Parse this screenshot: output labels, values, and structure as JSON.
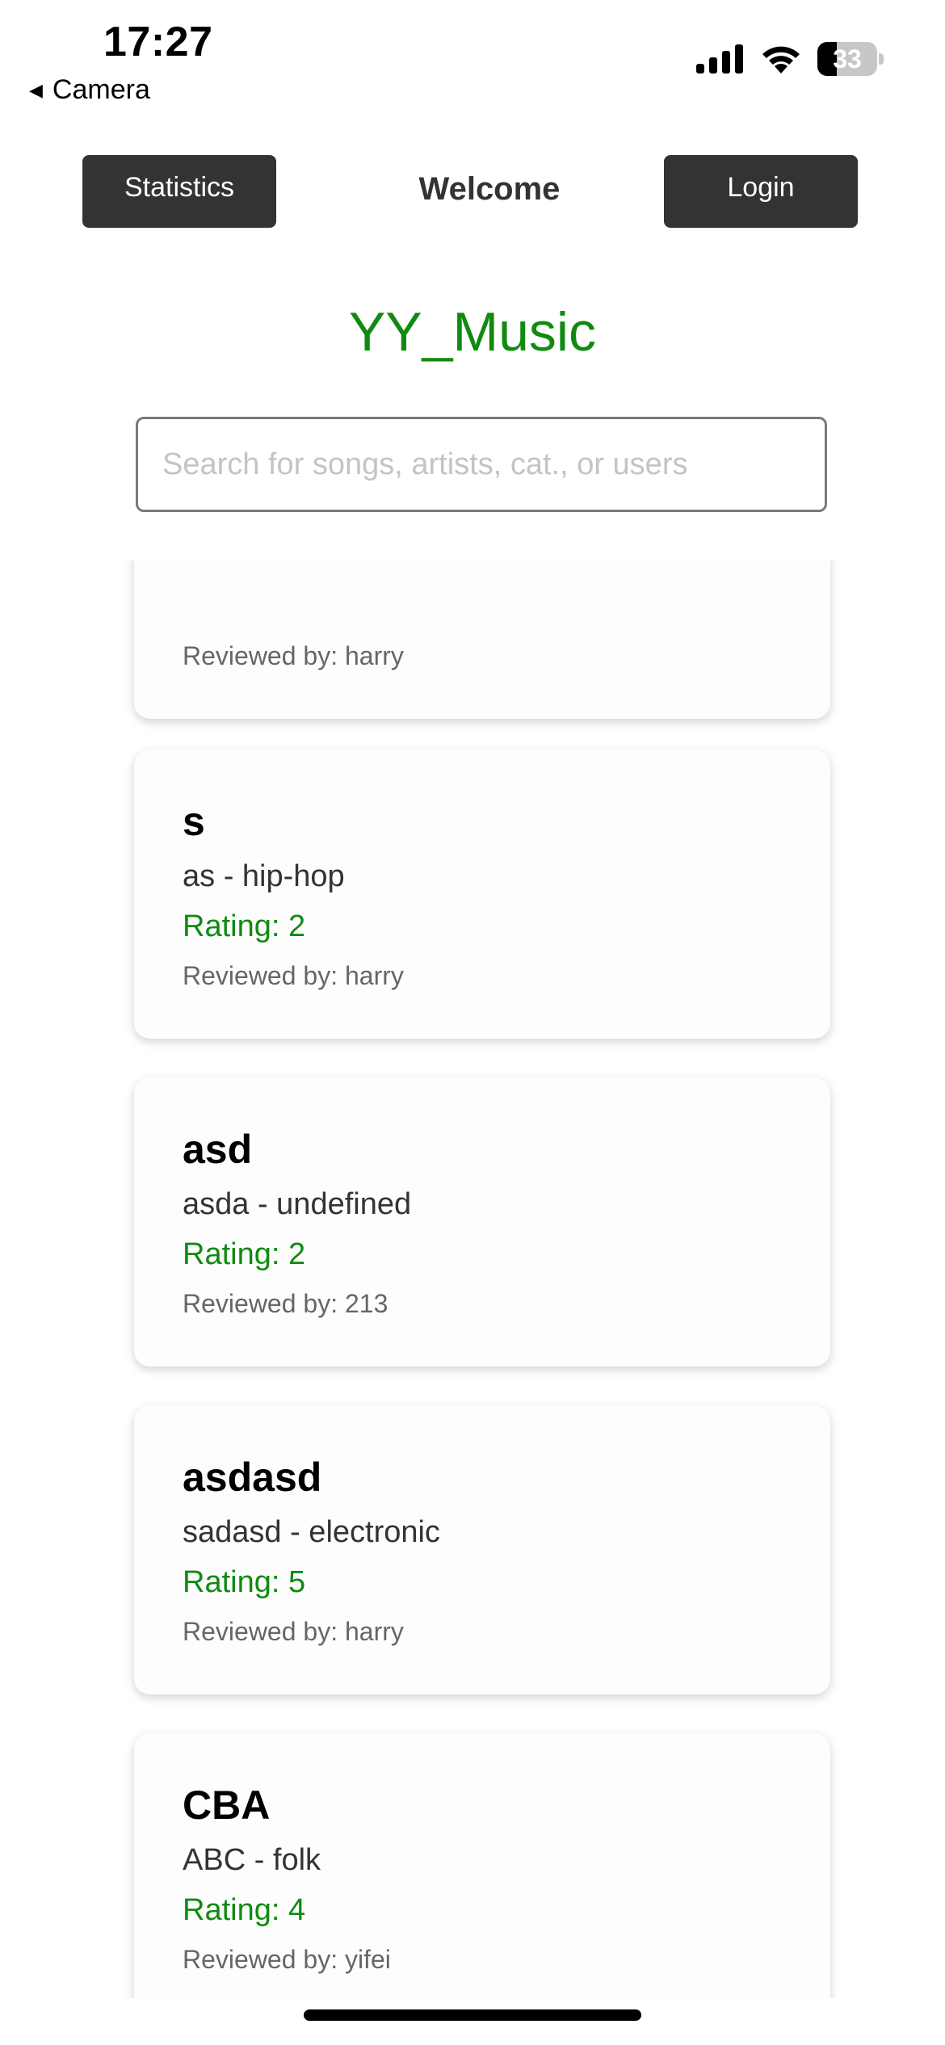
{
  "status_bar": {
    "time": "17:27",
    "back_label": "Camera",
    "battery_level": "33",
    "battery_fraction": 0.33
  },
  "header": {
    "statistics_label": "Statistics",
    "welcome_text": "Welcome",
    "login_label": "Login"
  },
  "app_title": "YY_Music",
  "search": {
    "placeholder": "Search for songs, artists, cat., or users",
    "value": ""
  },
  "reviews": [
    {
      "title": "",
      "meta": "",
      "rating": "",
      "reviewer": "Reviewed by: harry"
    },
    {
      "title": "s",
      "meta": "as - hip-hop",
      "rating": "Rating: 2",
      "reviewer": "Reviewed by: harry"
    },
    {
      "title": "asd",
      "meta": "asda - undefined",
      "rating": "Rating: 2",
      "reviewer": "Reviewed by: 213"
    },
    {
      "title": "asdasd",
      "meta": "sadasd - electronic",
      "rating": "Rating: 5",
      "reviewer": "Reviewed by: harry"
    },
    {
      "title": "CBA",
      "meta": "ABC - folk",
      "rating": "Rating: 4",
      "reviewer": "Reviewed by: yifei"
    }
  ],
  "colors": {
    "accent": "#118a11",
    "button_bg": "#333333"
  }
}
